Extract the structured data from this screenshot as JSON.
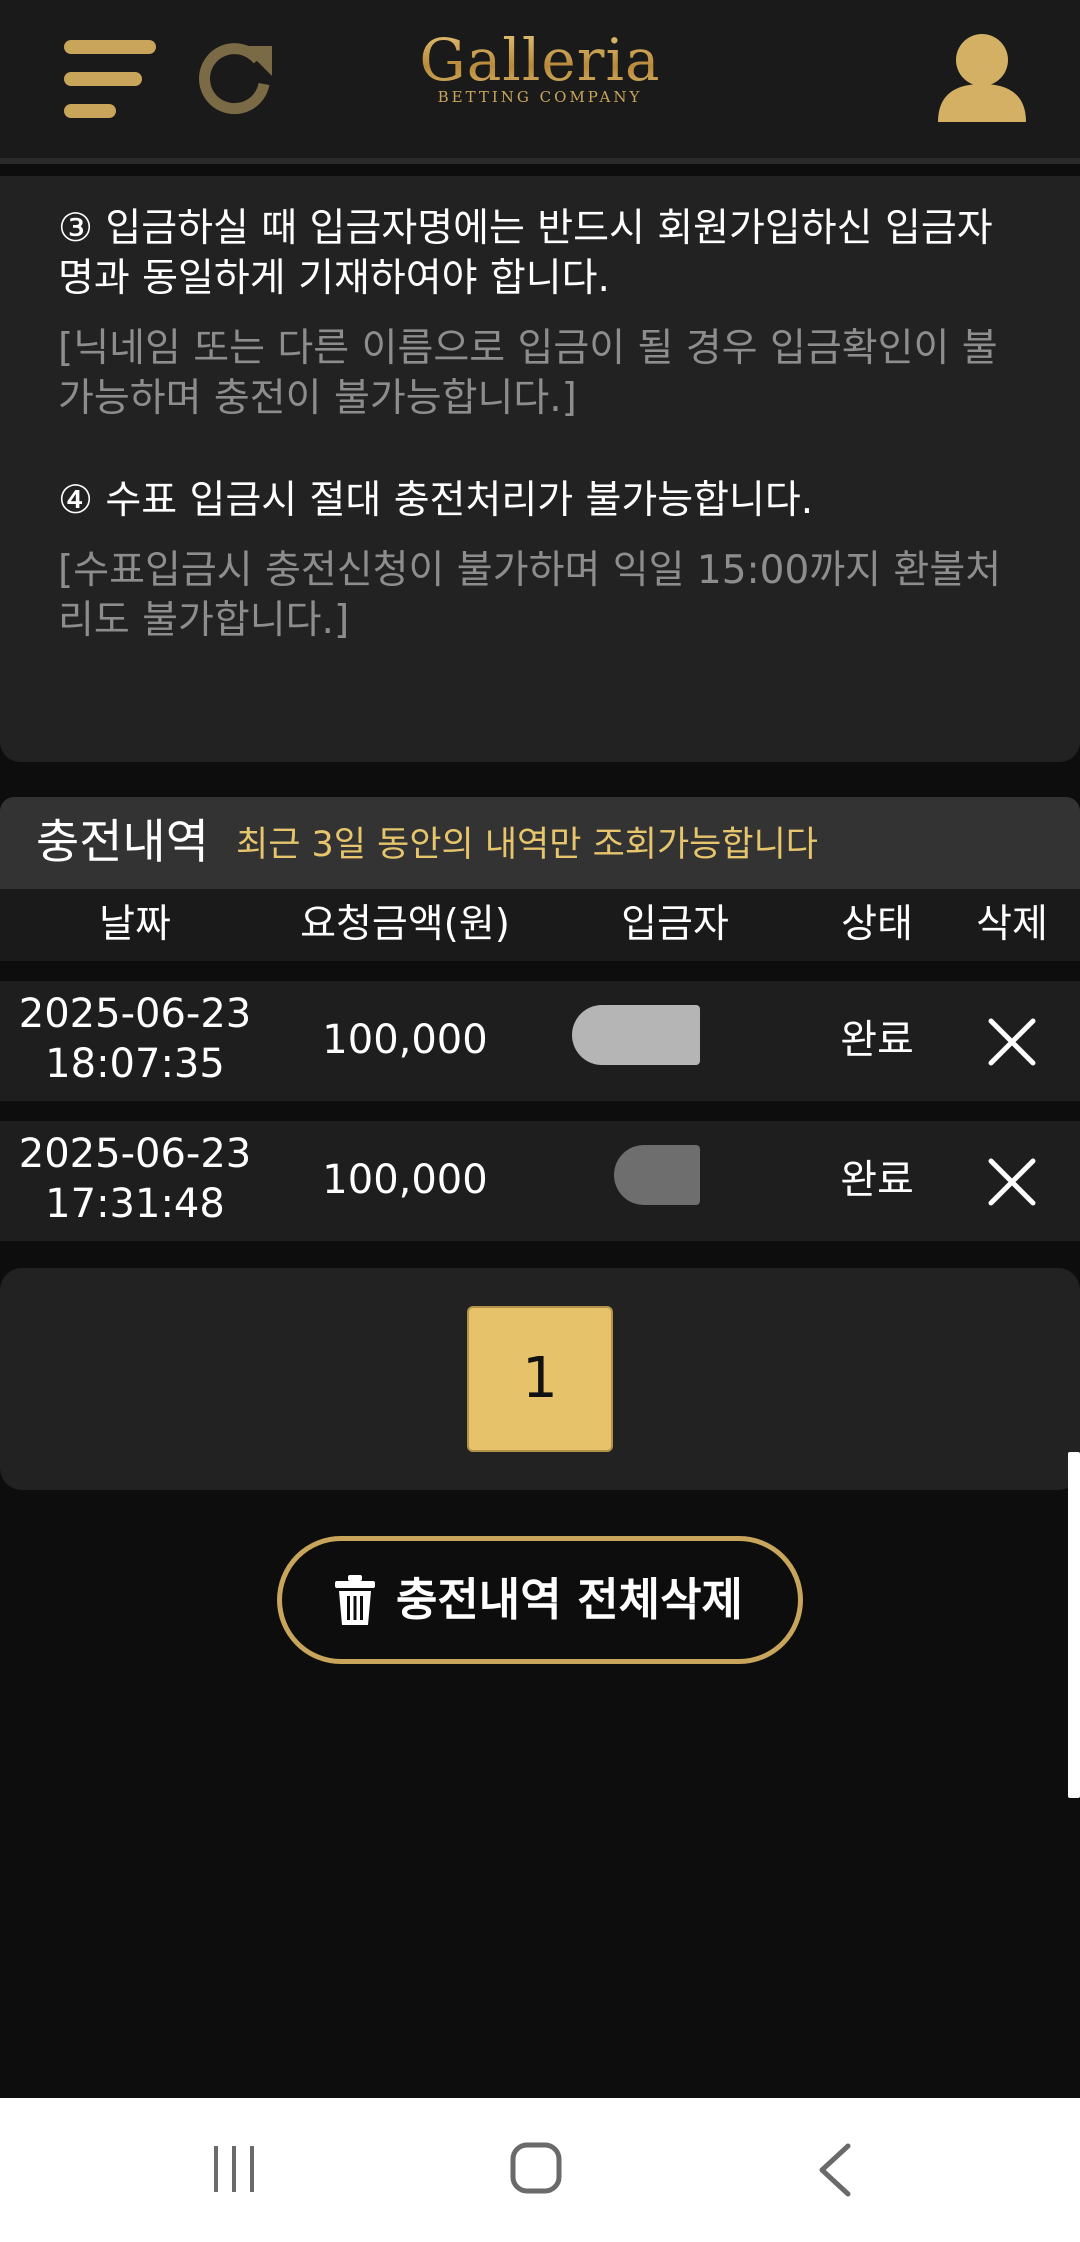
{
  "header": {
    "logo_name": "Galleria",
    "logo_sub": "BETTING COMPANY",
    "icons": [
      "menu-icon",
      "refresh-icon",
      "user-icon"
    ],
    "accent_color": "#c9a55b"
  },
  "notice": {
    "item3_main": "③ 입금하실 때 입금자명에는 반드시 회원가입하신 입금자명과 동일하게 기재하여야 합니다.",
    "item3_sub": "[닉네임 또는 다른 이름으로 입금이 될 경우 입금확인이 불가능하며 충전이 불가능합니다.]",
    "item4_main": "④ 수표 입금시 절대 충전처리가 불가능합니다.",
    "item4_sub": "[수표입금시 충전신청이 불가하며 익일 15:00까지 환불처리도 불가합니다.]"
  },
  "history": {
    "title": "충전내역",
    "note": "최근 3일 동안의 내역만 조회가능합니다",
    "columns": [
      "날짜",
      "요청금액(원)",
      "입금자",
      "상태",
      "삭제"
    ],
    "rows": [
      {
        "date": "2025-06-23",
        "time": "18:07:35",
        "amount": "100,000",
        "status": "완료"
      },
      {
        "date": "2025-06-23",
        "time": "17:31:48",
        "amount": "100,000",
        "status": "완료"
      }
    ]
  },
  "pagination": {
    "current_page": "1"
  },
  "delete_all_label": "충전내역 전체삭제",
  "navbar": {
    "icons": [
      "recent-apps-icon",
      "home-icon",
      "back-icon"
    ]
  }
}
